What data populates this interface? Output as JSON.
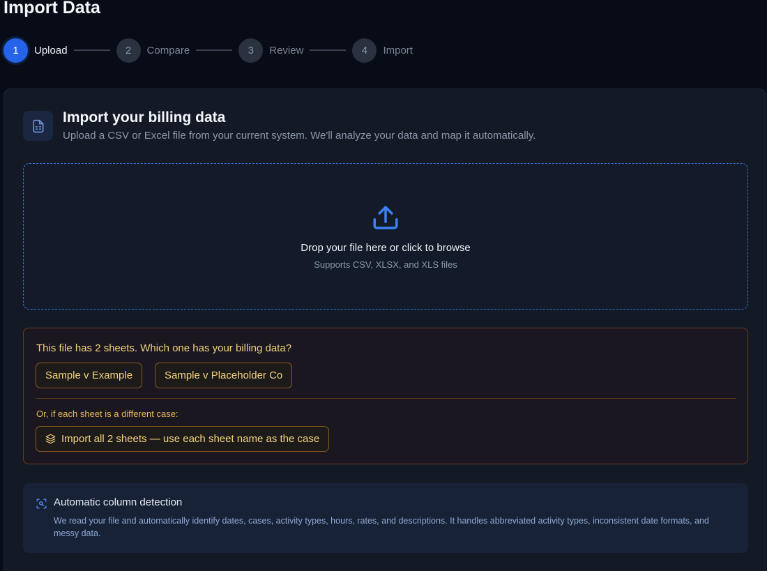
{
  "page": {
    "title": "Import Data"
  },
  "stepper": {
    "steps": [
      {
        "number": "1",
        "label": "Upload",
        "active": true
      },
      {
        "number": "2",
        "label": "Compare",
        "active": false
      },
      {
        "number": "3",
        "label": "Review",
        "active": false
      },
      {
        "number": "4",
        "label": "Import",
        "active": false
      }
    ]
  },
  "card": {
    "icon": "file-spreadsheet-icon",
    "title": "Import your billing data",
    "subtitle": "Upload a CSV or Excel file from your current system. We'll analyze your data and map it automatically."
  },
  "dropzone": {
    "icon": "upload-icon",
    "text": "Drop your file here or click to browse",
    "hint": "Supports CSV, XLSX, and XLS files"
  },
  "sheets": {
    "question": "This file has 2 sheets. Which one has your billing data?",
    "options": [
      "Sample v Example",
      "Sample v Placeholder Co"
    ],
    "or_text": "Or, if each sheet is a different case:",
    "import_all_icon": "layers-icon",
    "import_all_label": "Import all 2 sheets — use each sheet name as the case"
  },
  "info": {
    "icon": "scan-search-icon",
    "title": "Automatic column detection",
    "text": "We read your file and automatically identify dates, cases, activity types, hours, rates, and descriptions. It handles abbreviated activity types, inconsistent date formats, and messy data."
  },
  "colors": {
    "accent": "#2563eb",
    "dropzone_border": "#3a74d6",
    "warning_text": "#f2d27e",
    "warning_border": "#8a5a1f"
  }
}
